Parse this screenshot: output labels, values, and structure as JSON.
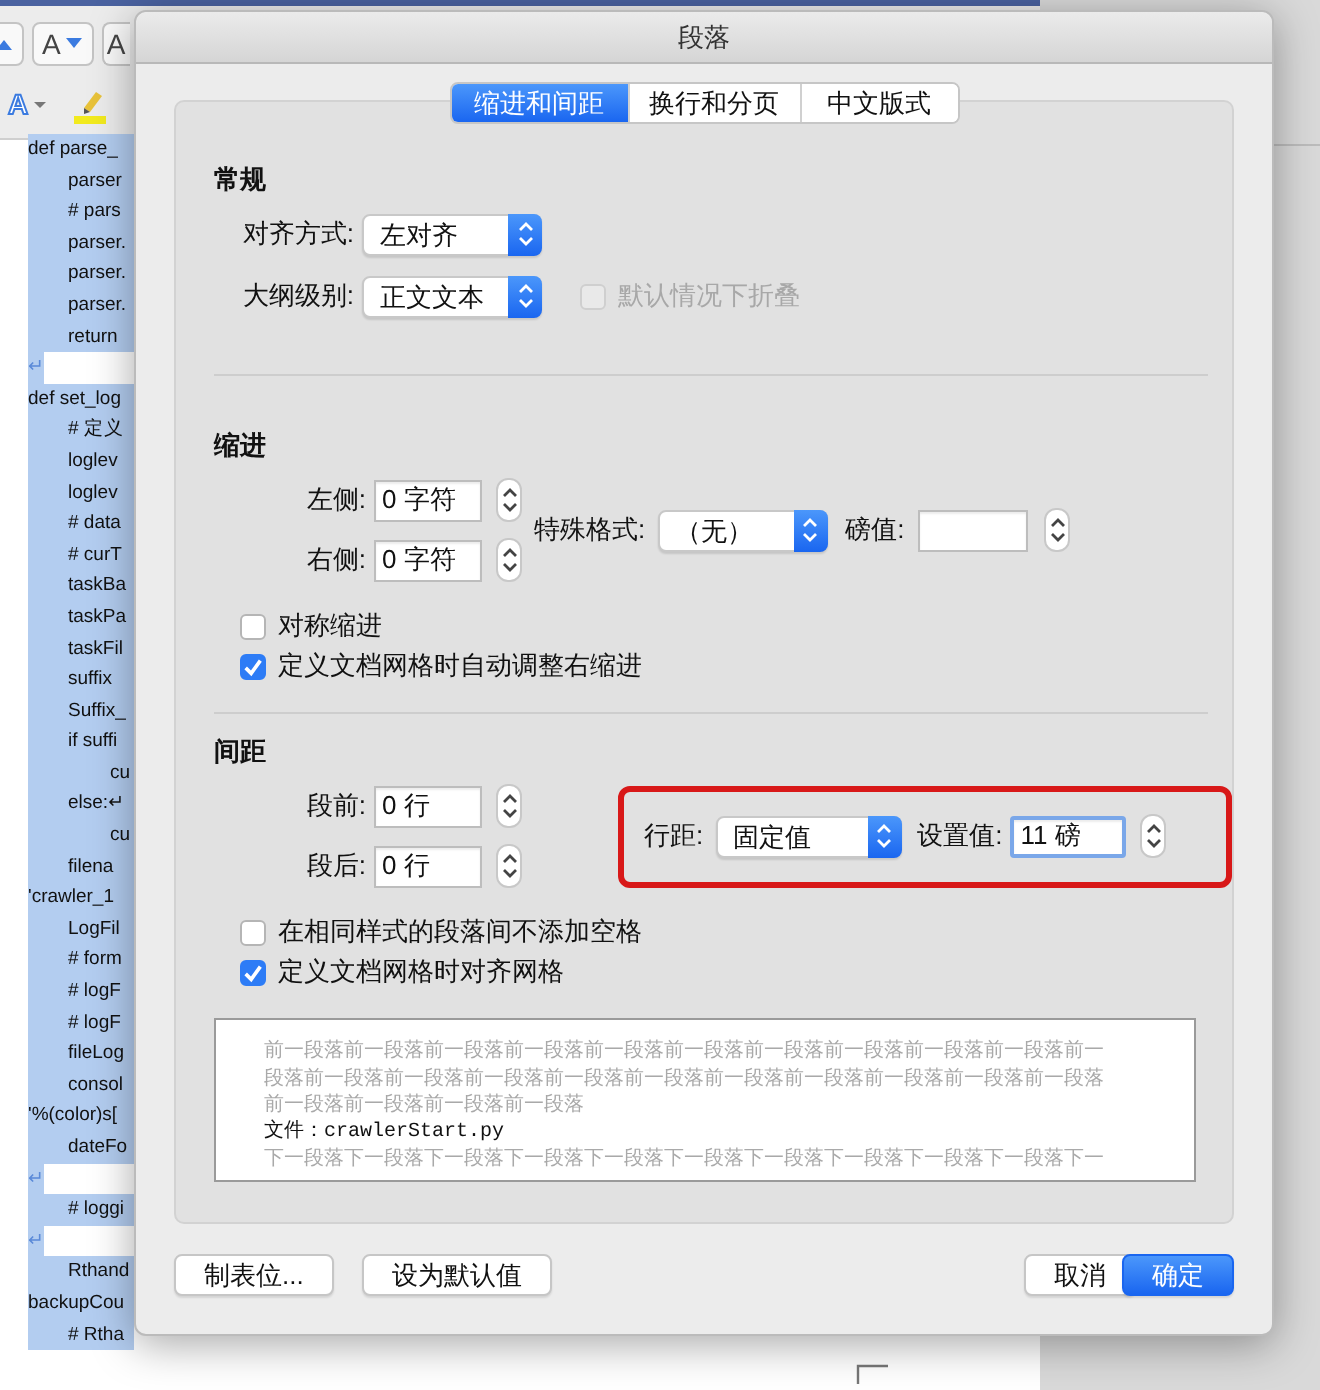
{
  "toolbar": [
    {
      "kind": "grow"
    },
    {
      "label": "A",
      "kind": "shrink"
    },
    {
      "label": "A",
      "kind": "plain"
    }
  ],
  "toolbar_row_2": [
    {
      "label": "A",
      "kind": "effects"
    },
    {
      "kind": "highlighter"
    }
  ],
  "document_lines": [
    {
      "text": "def parse_",
      "kind": "top"
    },
    {
      "text": "parser",
      "kind": "indented"
    },
    {
      "text": "# pars",
      "kind": "indented"
    },
    {
      "text": "parser.",
      "kind": "indented"
    },
    {
      "text": "parser.",
      "kind": "indented"
    },
    {
      "text": "parser.",
      "kind": "indented"
    },
    {
      "text": "return",
      "kind": "indented"
    },
    {
      "text": "↵",
      "kind": "blank"
    },
    {
      "text": "def set_log",
      "kind": "top"
    },
    {
      "text": "# 定义",
      "kind": "indented"
    },
    {
      "text": "loglev",
      "kind": "indented"
    },
    {
      "text": "loglev",
      "kind": "indented"
    },
    {
      "text": "# data",
      "kind": "indented"
    },
    {
      "text": "# curT",
      "kind": "indented"
    },
    {
      "text": "taskBa",
      "kind": "indented"
    },
    {
      "text": "taskPa",
      "kind": "indented"
    },
    {
      "text": "taskFil",
      "kind": "indented"
    },
    {
      "text": "suffix",
      "kind": "indented"
    },
    {
      "text": "Suffix_",
      "kind": "indented"
    },
    {
      "text": "if suffi",
      "kind": "indented"
    },
    {
      "text": "cu",
      "kind": "nested"
    },
    {
      "text": "else:↵",
      "kind": "indented"
    },
    {
      "text": "cu",
      "kind": "nested"
    },
    {
      "text": "filena",
      "kind": "indented"
    },
    {
      "text": "'crawler_1",
      "kind": "top"
    },
    {
      "text": "LogFil",
      "kind": "indented"
    },
    {
      "text": "# form",
      "kind": "indented"
    },
    {
      "text": "# logF",
      "kind": "indented"
    },
    {
      "text": "# logF",
      "kind": "indented"
    },
    {
      "text": "fileLog",
      "kind": "indented"
    },
    {
      "text": "consol",
      "kind": "indented"
    },
    {
      "text": "'%(color)s[",
      "kind": "top"
    },
    {
      "text": "dateFo",
      "kind": "indented"
    },
    {
      "text": "↵",
      "kind": "blank"
    },
    {
      "text": "# loggi",
      "kind": "indented"
    },
    {
      "text": "↵",
      "kind": "blank"
    },
    {
      "text": "Rthand",
      "kind": "indented"
    },
    {
      "text": "backupCou",
      "kind": "top"
    },
    {
      "text": "# Rtha",
      "kind": "indented"
    }
  ],
  "dialog": {
    "title": "段落",
    "tabs": [
      {
        "label": "缩进和间距",
        "selected": true
      },
      {
        "label": "换行和分页",
        "selected": false
      },
      {
        "label": "中文版式",
        "selected": false
      }
    ],
    "general": {
      "heading": "常规",
      "alignment": {
        "label": "对齐方式:",
        "value": "左对齐"
      },
      "outline_level": {
        "label": "大纲级别:",
        "value": "正文文本"
      },
      "collapse": {
        "label": "默认情况下折叠",
        "checked": false,
        "disabled": true
      }
    },
    "indentation": {
      "heading": "缩进",
      "left": {
        "label": "左侧:",
        "value": "0 字符"
      },
      "right": {
        "label": "右侧:",
        "value": "0 字符"
      },
      "special": {
        "label": "特殊格式:",
        "value": "（无）"
      },
      "by": {
        "label": "磅值:"
      },
      "checkboxes": [
        {
          "label": "对称缩进",
          "checked": false
        },
        {
          "label": "定义文档网格时自动调整右缩进",
          "checked": true
        }
      ]
    },
    "spacing": {
      "heading": "间距",
      "before": {
        "label": "段前:",
        "value": "0 行"
      },
      "after": {
        "label": "段后:",
        "value": "0 行"
      },
      "line_spacing": {
        "label": "行距:",
        "value": "固定值"
      },
      "at": {
        "label": "设置值:",
        "value": "11 磅"
      },
      "checkboxes": [
        {
          "label": "在相同样式的段落间不添加空格",
          "checked": false
        },
        {
          "label": "定义文档网格时对齐网格",
          "checked": true
        }
      ]
    },
    "preview": [
      {
        "text": "前一段落前一段落前一段落前一段落前一段落前一段落前一段落前一段落前一段落前一段落前一",
        "kind": "context"
      },
      {
        "text": "段落前一段落前一段落前一段落前一段落前一段落前一段落前一段落前一段落前一段落前一段落",
        "kind": "context"
      },
      {
        "text": "前一段落前一段落前一段落前一段落",
        "kind": "context"
      },
      {
        "text": "文件：crawlerStart.py",
        "kind": "current"
      },
      {
        "text": "下一段落下一段落下一段落下一段落下一段落下一段落下一段落下一段落下一段落下一段落下一",
        "kind": "context"
      }
    ],
    "buttons": [
      {
        "label": "制表位...",
        "kind": "normal"
      },
      {
        "label": "设为默认值",
        "kind": "normal"
      },
      {
        "label": "取消",
        "kind": "normal"
      },
      {
        "label": "确定",
        "kind": "default"
      }
    ]
  }
}
